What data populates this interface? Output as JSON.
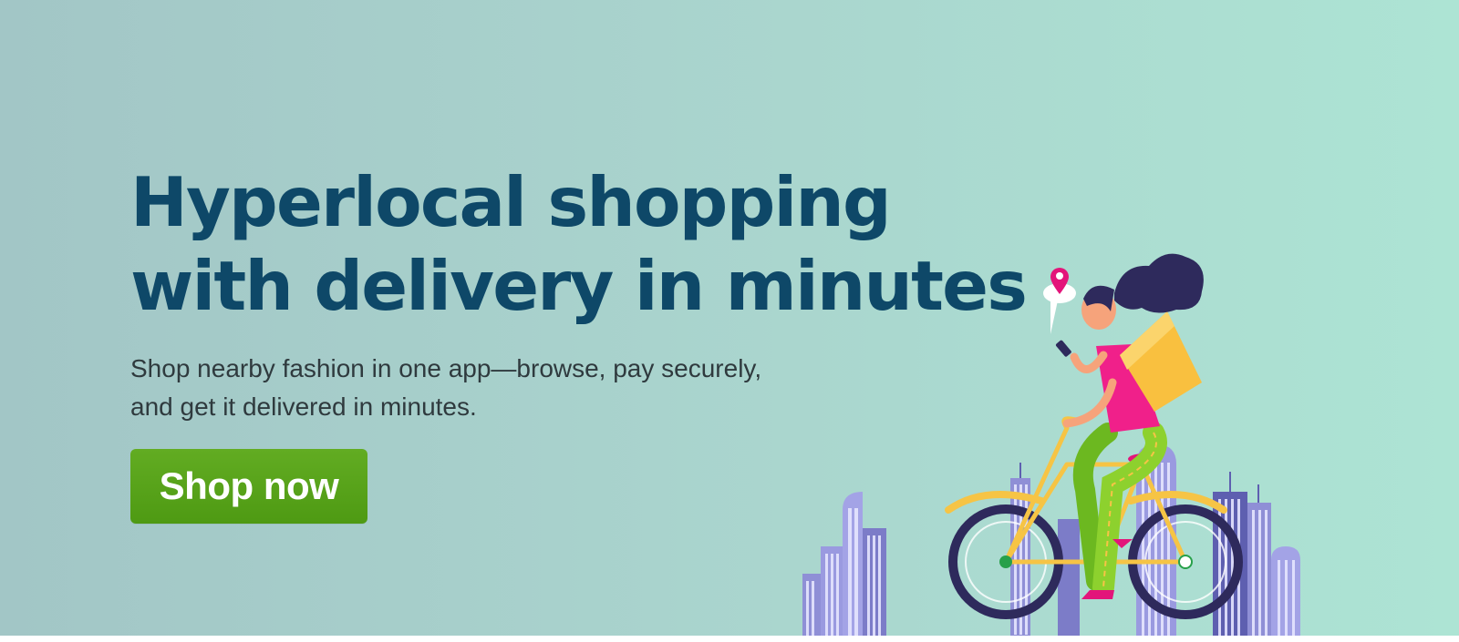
{
  "hero": {
    "headline_line1": "Hyperlocal shopping",
    "headline_line2": "with delivery in minutes",
    "subtext_line1": "Shop nearby fashion in one app—browse, pay securely,",
    "subtext_line2": "and get it delivered in minutes.",
    "cta_label": "Shop now"
  },
  "illustration": {
    "name": "delivery-rider-illustration",
    "colors": {
      "buildings": "#8f8fd6",
      "buildings_dark": "#5e5fb0",
      "bike_frame": "#f6c445",
      "wheel": "#2e2a5c",
      "top": "#f0208a",
      "pants": "#8dd12e",
      "hair": "#2e2a5c",
      "box": "#f9c03f",
      "pin": "#e3157a"
    }
  },
  "theme": {
    "headline_color": "#0e4868",
    "cta_color": "#58a31a"
  }
}
